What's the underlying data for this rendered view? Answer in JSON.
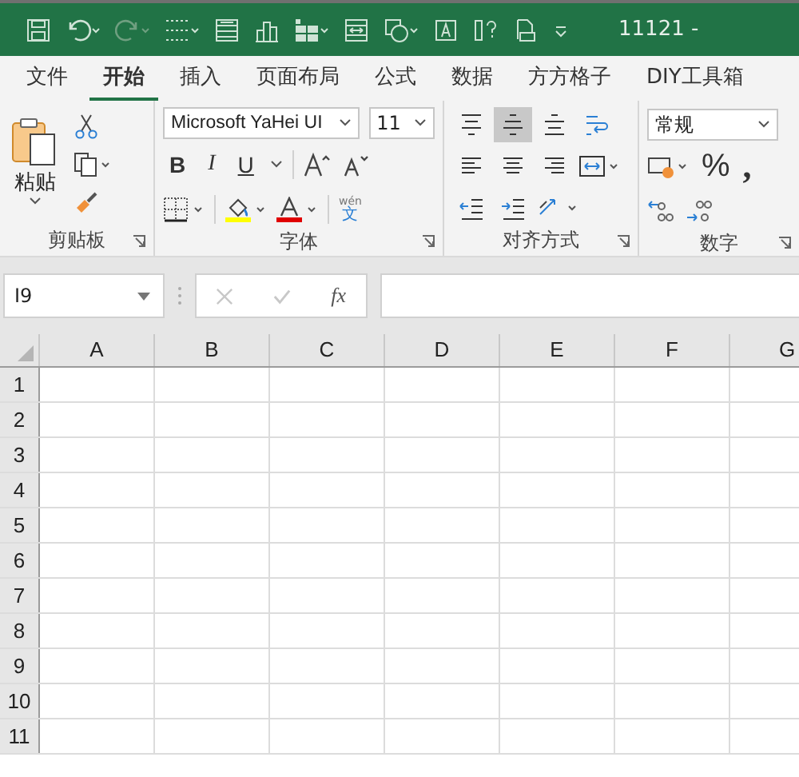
{
  "title_bar": {
    "title": "11121 -"
  },
  "tabs": [
    {
      "label": "文件",
      "selected": false
    },
    {
      "label": "开始",
      "selected": true
    },
    {
      "label": "插入",
      "selected": false
    },
    {
      "label": "页面布局",
      "selected": false
    },
    {
      "label": "公式",
      "selected": false
    },
    {
      "label": "数据",
      "selected": false
    },
    {
      "label": "方方格子",
      "selected": false
    },
    {
      "label": "DIY工具箱",
      "selected": false
    }
  ],
  "clipboard": {
    "paste_label": "粘贴",
    "group_label": "剪贴板"
  },
  "font": {
    "font_name": "Microsoft YaHei UI",
    "font_size": "11",
    "bold": "B",
    "italic": "I",
    "underline": "U",
    "phonetic_top": "wén",
    "phonetic_bottom": "文",
    "group_label": "字体"
  },
  "alignment": {
    "buttons": [
      {
        "kind": "top",
        "selected": false
      },
      {
        "kind": "middle",
        "selected": true
      },
      {
        "kind": "bottom",
        "selected": false
      },
      {
        "kind": "wrap",
        "selected": false
      },
      {
        "kind": "left",
        "selected": false
      },
      {
        "kind": "center",
        "selected": false
      },
      {
        "kind": "right",
        "selected": false
      },
      {
        "kind": "merge",
        "selected": false
      },
      {
        "kind": "outdent",
        "selected": false
      },
      {
        "kind": "indent",
        "selected": false
      },
      {
        "kind": "orient",
        "selected": false
      }
    ],
    "group_label": "对齐方式"
  },
  "number": {
    "format": "常规",
    "percent": "%",
    "comma": ",",
    "group_label": "数字"
  },
  "formula_bar": {
    "name_box": "I9",
    "fx": "fx"
  },
  "sheet": {
    "columns": [
      "A",
      "B",
      "C",
      "D",
      "E",
      "F",
      "G"
    ],
    "rows": [
      "1",
      "2",
      "3",
      "4",
      "5",
      "6",
      "7",
      "8",
      "9",
      "10",
      "11"
    ]
  }
}
